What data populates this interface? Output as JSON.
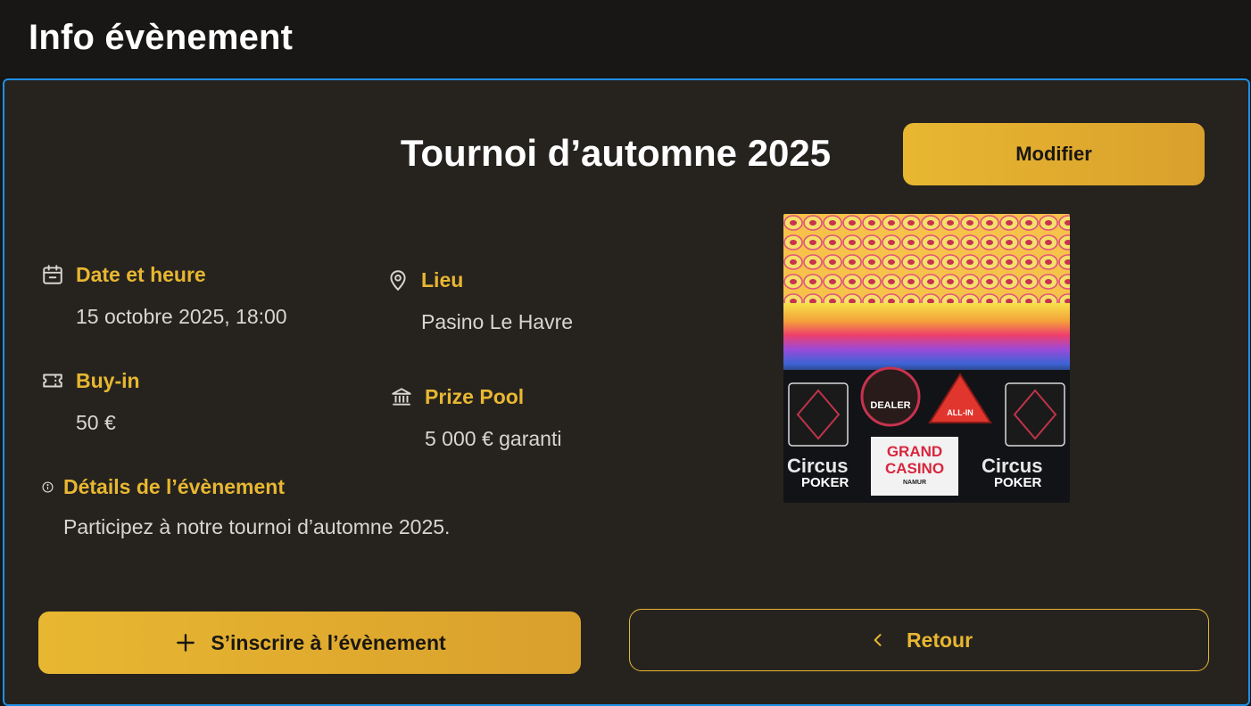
{
  "header": {
    "title": "Info évènement"
  },
  "event": {
    "title": "Tournoi d’automne 2025",
    "edit_label": "Modifier",
    "date": {
      "label": "Date et heure",
      "value": "15 octobre 2025, 18:00",
      "icon": "calendar-icon"
    },
    "location": {
      "label": "Lieu",
      "value": "Pasino Le Havre",
      "icon": "map-pin-icon"
    },
    "buyin": {
      "label": "Buy-in",
      "value": "50 €",
      "icon": "ticket-icon"
    },
    "prize": {
      "label": "Prize Pool",
      "value": "5 000 € garanti",
      "icon": "bank-icon"
    },
    "details": {
      "label": "Détails de l’évènement",
      "value": "Participez à notre tournoi d’automne 2025.",
      "icon": "info-icon"
    },
    "image": {
      "name": "poker-chips-image",
      "logo_texts": [
        "DEALER",
        "ALL-IN",
        "Circus POKER",
        "Circus GRAND CASINO NAMUR",
        "Circus POKER"
      ]
    }
  },
  "actions": {
    "register_label": "S’inscrire à l’évènement",
    "back_label": "Retour"
  },
  "colors": {
    "accent": "#e8b731",
    "panel": "#26231f",
    "panel_border": "#1f8fe6",
    "background": "#161513"
  }
}
